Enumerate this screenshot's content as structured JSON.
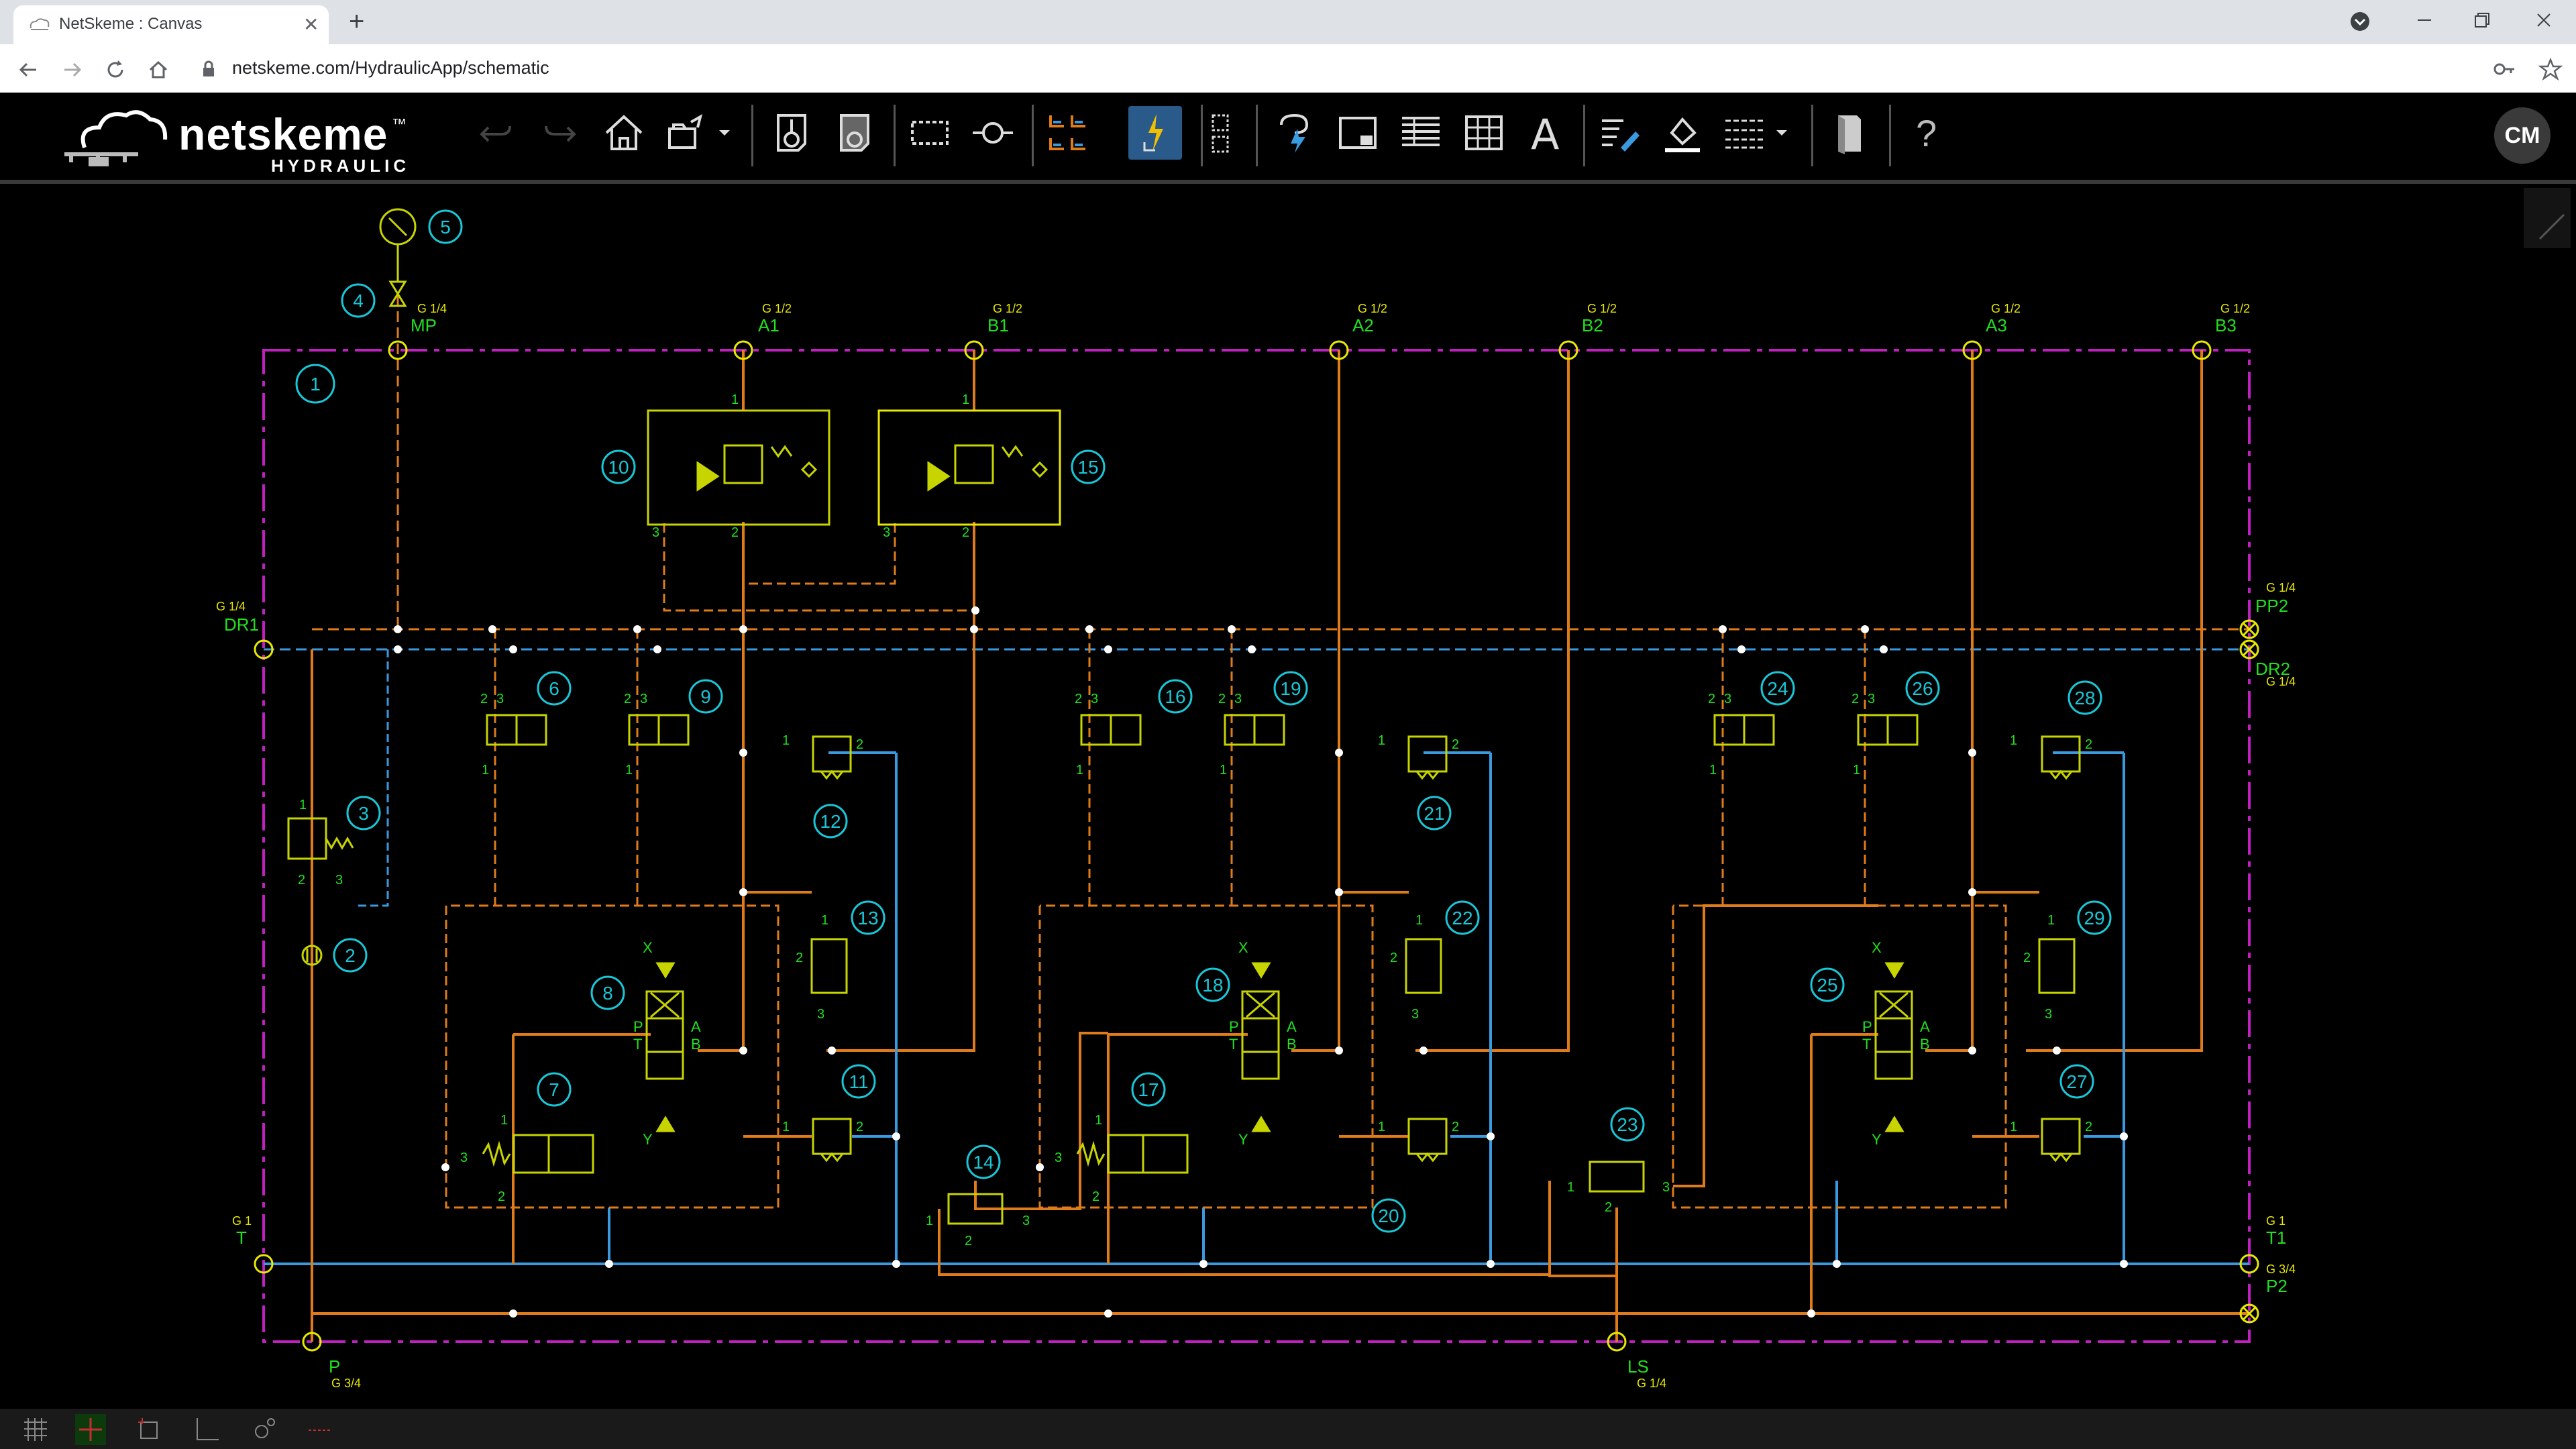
{
  "browser": {
    "tab_title": "NetSkeme : Canvas",
    "url": "netskeme.com/HydraulicApp/schematic",
    "new_tab_glyph": "+",
    "close_glyph": "✕"
  },
  "app": {
    "logo_text": "netskeme",
    "logo_tm": "™",
    "logo_sub": "HYDRAULIC",
    "user_initials": "CM",
    "toolbar_icons": [
      "undo-icon",
      "redo-icon",
      "home-icon",
      "open-icon",
      "component-insert-icon",
      "component-remove-icon",
      "select-rect-icon",
      "connect-icon",
      "align-icon",
      "power-connect-icon",
      "group-icon",
      "flow-icon",
      "frame-icon",
      "table-list-icon",
      "table-grid-icon",
      "text-icon",
      "edit-lines-icon",
      "fill-icon",
      "line-style-icon",
      "library-icon",
      "help-icon"
    ],
    "text_tool_glyph": "A",
    "help_glyph": "?"
  },
  "colors": {
    "pressure": "#e07b1a",
    "return": "#3a9ae0",
    "pilot": "#e07b1a",
    "manifold": "#c020c0",
    "component": "#c8d400",
    "label_cyan": "#18c8d8",
    "port_yellow": "#e8e800",
    "port_name": "#20e020"
  },
  "schematic": {
    "ports": [
      {
        "name": "MP",
        "thread": "G 1/4"
      },
      {
        "name": "A1",
        "thread": "G 1/2"
      },
      {
        "name": "B1",
        "thread": "G 1/2"
      },
      {
        "name": "A2",
        "thread": "G 1/2"
      },
      {
        "name": "B2",
        "thread": "G 1/2"
      },
      {
        "name": "A3",
        "thread": "G 1/2"
      },
      {
        "name": "B3",
        "thread": "G 1/2"
      },
      {
        "name": "DR1",
        "thread": "G 1/4"
      },
      {
        "name": "PP2",
        "thread": "G 1/4"
      },
      {
        "name": "DR2",
        "thread": "G 1/4"
      },
      {
        "name": "T",
        "thread": "G 1"
      },
      {
        "name": "T1",
        "thread": "G 1"
      },
      {
        "name": "P2",
        "thread": "G 3/4"
      },
      {
        "name": "P",
        "thread": "G 3/4"
      },
      {
        "name": "LS",
        "thread": "G 1/4"
      }
    ],
    "component_ids": [
      "1",
      "2",
      "3",
      "4",
      "5",
      "6",
      "7",
      "8",
      "9",
      "10",
      "11",
      "12",
      "13",
      "14",
      "15",
      "16",
      "17",
      "18",
      "19",
      "20",
      "21",
      "22",
      "23",
      "24",
      "25",
      "26",
      "27",
      "28",
      "29"
    ],
    "pin_numbers": [
      "1",
      "2",
      "3"
    ],
    "pin_letters": [
      "X",
      "Y",
      "P",
      "T",
      "A",
      "B"
    ]
  }
}
